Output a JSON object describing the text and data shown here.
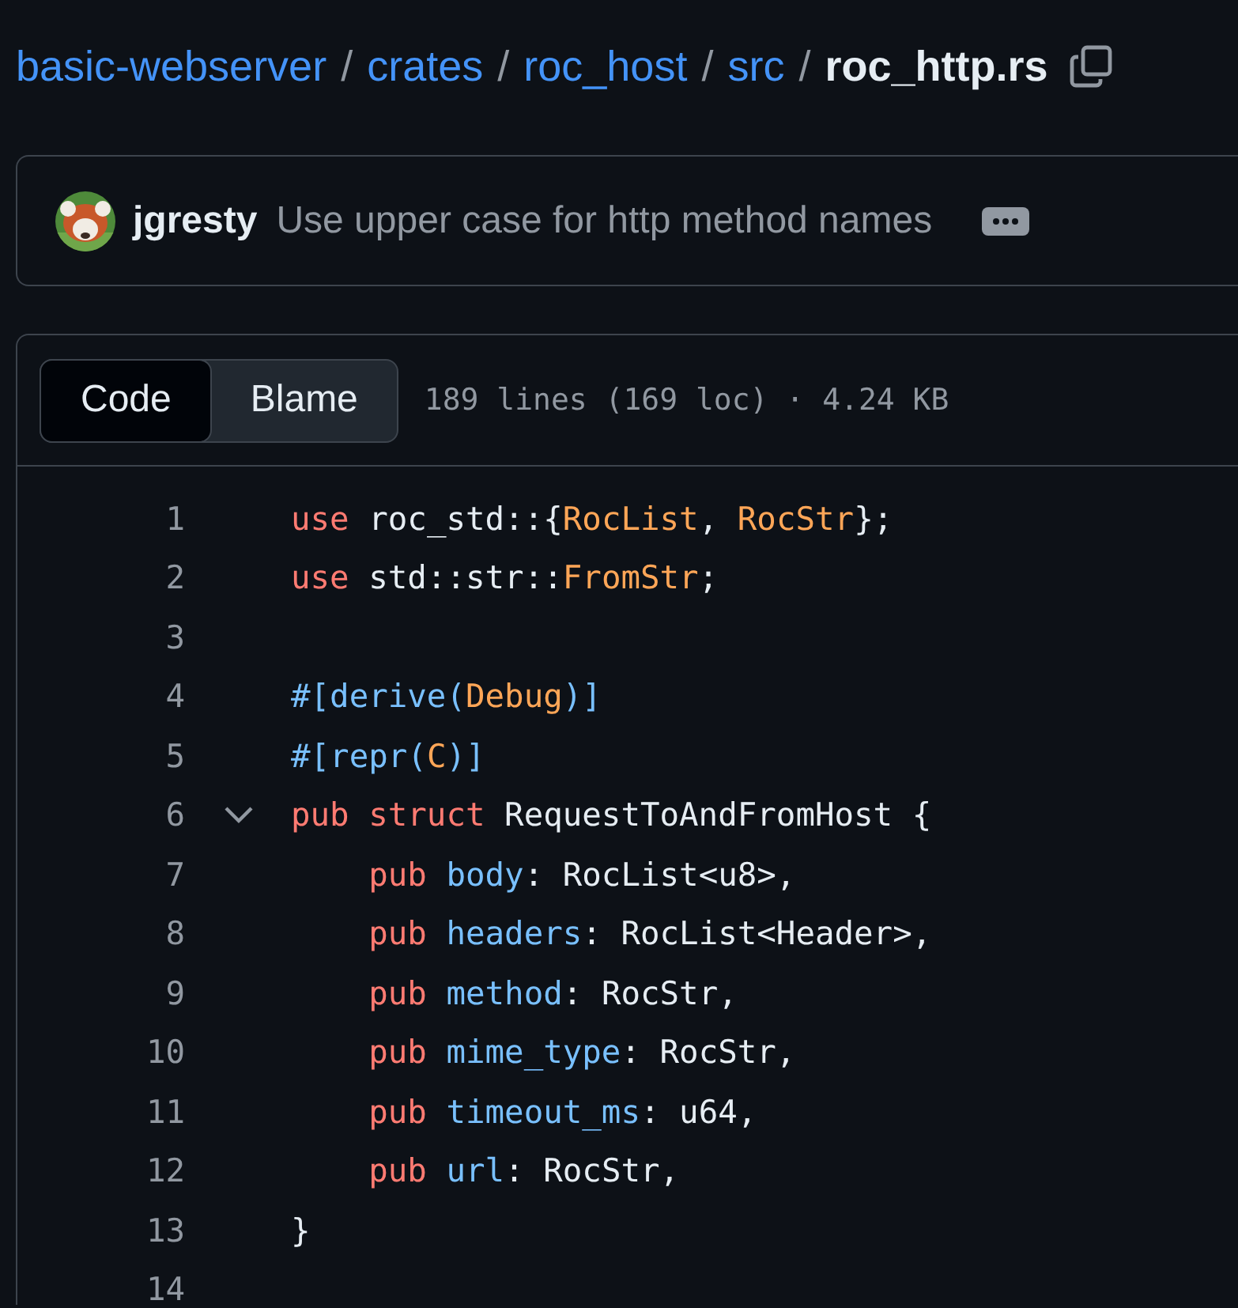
{
  "breadcrumb": {
    "parts": [
      {
        "label": "basic-webserver",
        "current": false
      },
      {
        "label": "crates",
        "current": false
      },
      {
        "label": "roc_host",
        "current": false
      },
      {
        "label": "src",
        "current": false
      },
      {
        "label": "roc_http.rs",
        "current": true
      }
    ],
    "separator": "/"
  },
  "commit": {
    "author": "jgresty",
    "message": "Use upper case for http method names"
  },
  "view_tabs": [
    {
      "label": "Code",
      "selected": true
    },
    {
      "label": "Blame",
      "selected": false
    }
  ],
  "file_info": "189 lines (169 loc) · 4.24 KB",
  "code_lines": [
    {
      "number": "1",
      "tokens": [
        {
          "kind": "keyword",
          "text": "use",
          "space_after": true
        },
        {
          "kind": "plain",
          "text": "roc_std::{",
          "space_after": false
        },
        {
          "kind": "entity",
          "text": "RocList",
          "space_after": false
        },
        {
          "kind": "plain",
          "text": ",",
          "space_after": true
        },
        {
          "kind": "entity",
          "text": "RocStr",
          "space_after": false
        },
        {
          "kind": "plain",
          "text": "};",
          "space_after": false
        }
      ]
    },
    {
      "number": "2",
      "tokens": [
        {
          "kind": "keyword",
          "text": "use",
          "space_after": true
        },
        {
          "kind": "plain",
          "text": "std::str::",
          "space_after": false
        },
        {
          "kind": "entity",
          "text": "FromStr",
          "space_after": false
        },
        {
          "kind": "plain",
          "text": ";",
          "space_after": false
        }
      ]
    },
    {
      "number": "3"
    },
    {
      "number": "4",
      "tokens": [
        {
          "kind": "prop",
          "text": "#[derive(",
          "space_after": false
        },
        {
          "kind": "entity",
          "text": "Debug",
          "space_after": false
        },
        {
          "kind": "prop",
          "text": ")]",
          "space_after": false
        }
      ]
    },
    {
      "number": "5",
      "tokens": [
        {
          "kind": "prop",
          "text": "#[repr(",
          "space_after": false
        },
        {
          "kind": "entity",
          "text": "C",
          "space_after": false
        },
        {
          "kind": "prop",
          "text": ")]",
          "space_after": false
        }
      ]
    },
    {
      "number": "6",
      "expanded": true,
      "tokens": [
        {
          "kind": "keyword",
          "text": "pub struct",
          "space_after": true
        },
        {
          "kind": "plain",
          "text": "RequestToAndFromHost {",
          "space_after": false
        }
      ],
      "children": [
        {
          "number": "7",
          "tokens": [
            {
              "kind": "keyword",
              "text": "pub",
              "space_after": true
            },
            {
              "kind": "prop",
              "text": "body",
              "space_after": false
            },
            {
              "kind": "plain",
              "text": ": RocList<u8>,",
              "space_after": false
            }
          ]
        },
        {
          "number": "8",
          "tokens": [
            {
              "kind": "keyword",
              "text": "pub",
              "space_after": true
            },
            {
              "kind": "prop",
              "text": "headers",
              "space_after": false
            },
            {
              "kind": "plain",
              "text": ": RocList<Header>,",
              "space_after": false
            }
          ]
        },
        {
          "number": "9",
          "tokens": [
            {
              "kind": "keyword",
              "text": "pub",
              "space_after": true
            },
            {
              "kind": "prop",
              "text": "method",
              "space_after": false
            },
            {
              "kind": "plain",
              "text": ": RocStr,",
              "space_after": false
            }
          ]
        },
        {
          "number": "10",
          "tokens": [
            {
              "kind": "keyword",
              "text": "pub",
              "space_after": true
            },
            {
              "kind": "prop",
              "text": "mime_type",
              "space_after": false
            },
            {
              "kind": "plain",
              "text": ": RocStr,",
              "space_after": false
            }
          ]
        },
        {
          "number": "11",
          "tokens": [
            {
              "kind": "keyword",
              "text": "pub",
              "space_after": true
            },
            {
              "kind": "prop",
              "text": "timeout_ms",
              "space_after": false
            },
            {
              "kind": "plain",
              "text": ": u64,",
              "space_after": false
            }
          ]
        },
        {
          "number": "12",
          "tokens": [
            {
              "kind": "keyword",
              "text": "pub",
              "space_after": true
            },
            {
              "kind": "prop",
              "text": "url",
              "space_after": false
            },
            {
              "kind": "plain",
              "text": ": RocStr,",
              "space_after": false
            }
          ]
        }
      ]
    },
    {
      "number": "13",
      "tokens": [
        {
          "kind": "plain",
          "text": "}",
          "space_after": false
        }
      ]
    },
    {
      "number": "14"
    }
  ]
}
